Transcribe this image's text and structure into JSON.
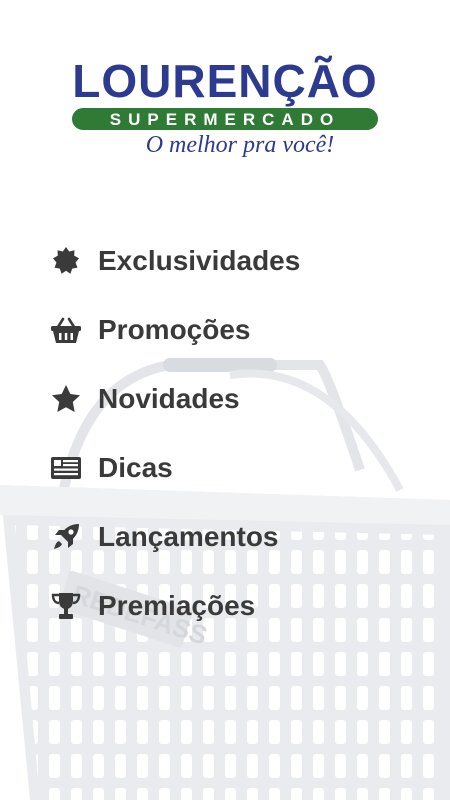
{
  "logo": {
    "name": "LOURENÇÃO",
    "subtitle": "SUPERMERCADO",
    "tagline": "O melhor pra você!"
  },
  "colors": {
    "brand_blue": "#2c3a8f",
    "brand_green": "#2f7a34",
    "menu_text": "#3a3a3a"
  },
  "menu": {
    "items": [
      {
        "label": "Exclusividades",
        "icon": "badge-icon"
      },
      {
        "label": "Promoções",
        "icon": "basket-icon"
      },
      {
        "label": "Novidades",
        "icon": "star-icon"
      },
      {
        "label": "Dicas",
        "icon": "newspaper-icon"
      },
      {
        "label": "Lançamentos",
        "icon": "rocket-icon"
      },
      {
        "label": "Premiações",
        "icon": "trophy-icon"
      }
    ]
  },
  "background": {
    "basket_text": "REDEFASS"
  }
}
